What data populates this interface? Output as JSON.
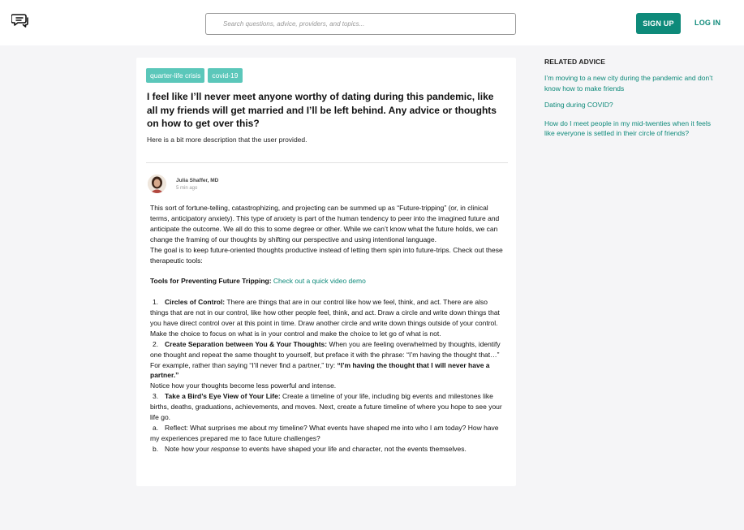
{
  "header": {
    "logo_icon": "chat-bubbles-icon",
    "search_placeholder": "Search questions, advice, providers, and topics...",
    "signup_label": "SIGN UP",
    "login_label": "LOG IN",
    "accent_color": "#0e8a7a"
  },
  "question": {
    "tags": [
      "quarter-life crisis",
      "covid-19"
    ],
    "title": "I feel like I’ll never meet anyone worthy of dating during this pandemic, like all my friends will get married and I’ll be left behind. Any advice or thoughts on how to get over this?",
    "description": "Here is a bit more description that the user provided."
  },
  "answer": {
    "author": "Julia Shaffer, MD",
    "time": "5 min ago",
    "para1": "This sort of fortune-telling, catastrophizing, and projecting can be summed up as “Future-tripping” (or, in clinical terms, anticipatory anxiety). This type of anxiety is part of the human tendency to peer into the imagined future and anticipate the outcome. We all do this to some degree or other. While we can’t know what the future holds, we can change the framing of our thoughts by shifting our perspective and using intentional language.",
    "para2": "The goal is to keep future-oriented thoughts productive instead of letting them spin into future-trips. Check out these therapeutic tools:",
    "tools_label": "Tools for Preventing Future Tripping:",
    "tools_link": "Check out a quick video demo",
    "item1_num": "1.",
    "item1_title": "Circles of Control:",
    "item1_text": " There are things that are in our control like how we feel, think, and act. There are also things that are not in our control, like how other people feel, think, and act. Draw a circle and write down things that you have direct control over at this point in time. Draw another circle and write down things outside of your control. Make the choice to focus on what is in your control and make the choice to let go of what is not.",
    "item2_num": "2.",
    "item2_title": "Create Separation between You & Your Thoughts:",
    "item2_text": " When you are feeling overwhelmed by thoughts, identify one thought and repeat the same thought to yourself, but preface it with the phrase: “I’m having the thought that…” For example, rather than saying “I’ll never find a partner,” try: ",
    "item2_bold": "“I’m having the thought that I will never have a partner.”",
    "item2_note": "Notice how your thoughts become less powerful and intense.",
    "item3_num": "3.",
    "item3_title": "Take a Bird’s Eye View of Your Life:",
    "item3_text": " Create a timeline of your life, including big events and milestones like births, deaths, graduations, achievements, and moves. Next, create a future timeline of where you hope to see your life go.",
    "itema_num": "a.",
    "itema_text": "Reflect: What surprises me about my timeline? What events have shaped me into who I am today? How have my experiences prepared me to face future challenges?",
    "itemb_num": "b.",
    "itemb_pre": "Note how your ",
    "itemb_em": "response",
    "itemb_post": " to events have shaped your life and character, not the events themselves."
  },
  "related": {
    "heading": "RELATED ADVICE",
    "items": [
      "I’m moving to a new city during the pandemic and don’t know how to make friends",
      "Dating during COVID?",
      "How do I meet people in my mid-twenties when it feels like everyone is settled in their circle of friends?"
    ]
  }
}
